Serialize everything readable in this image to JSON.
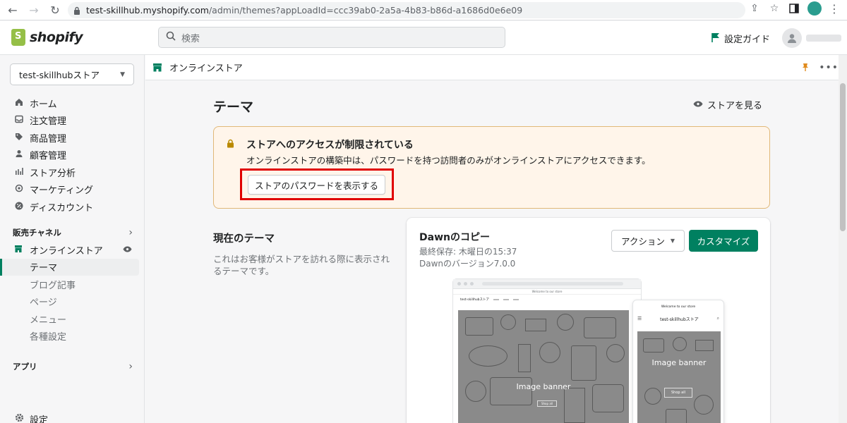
{
  "browser": {
    "url_host": "test-skillhub.myshopify.com",
    "url_path": "/admin/themes?appLoadId=ccc39ab0-2a5a-4b83-b86d-a1686d0e6e09"
  },
  "topbar": {
    "logo_text": "shopify",
    "search_placeholder": "検索",
    "setup_guide": "設定ガイド"
  },
  "sidebar": {
    "store_name": "test-skillhubストア",
    "items": [
      {
        "label": "ホーム",
        "icon": "home-icon"
      },
      {
        "label": "注文管理",
        "icon": "inbox-icon"
      },
      {
        "label": "商品管理",
        "icon": "tag-icon"
      },
      {
        "label": "顧客管理",
        "icon": "person-icon"
      },
      {
        "label": "ストア分析",
        "icon": "bar-chart-icon"
      },
      {
        "label": "マーケティング",
        "icon": "target-icon"
      },
      {
        "label": "ディスカウント",
        "icon": "discount-icon"
      }
    ],
    "sales_channels": "販売チャネル",
    "online_store": "オンラインストア",
    "sub_items": [
      "テーマ",
      "ブログ記事",
      "ページ",
      "メニュー",
      "各種設定"
    ],
    "apps": "アプリ",
    "settings": "設定"
  },
  "content_header": {
    "title": "オンラインストア"
  },
  "page": {
    "title": "テーマ",
    "view_store": "ストアを見る"
  },
  "banner": {
    "title": "ストアへのアクセスが制限されている",
    "text": "オンラインストアの構築中は、パスワードを持つ訪問者のみがオンラインストアにアクセスできます。",
    "button": "ストアのパスワードを表示する"
  },
  "current_theme": {
    "heading": "現在のテーマ",
    "description": "これはお客様がストアを訪れる際に表示されるテーマです。",
    "name": "Dawnのコピー",
    "last_saved": "最終保存: 木曜日の15:37",
    "version": "Dawnのバージョン7.0.0",
    "action_button": "アクション",
    "customize_button": "カスタマイズ"
  },
  "preview": {
    "announcement": "Welcome to our store",
    "desktop_store_name": "test-skillhubストア",
    "mobile_store_name": "test-skillhubストア",
    "hero_label": "Image banner",
    "shop_button": "Shop all"
  }
}
